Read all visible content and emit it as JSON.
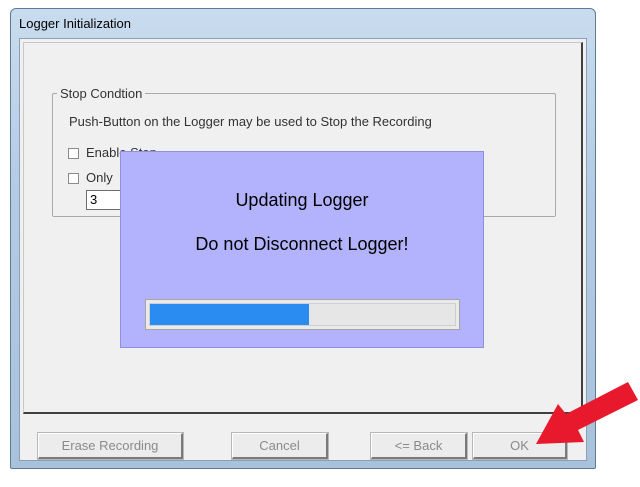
{
  "window": {
    "title": "Logger Initialization"
  },
  "stop_condition": {
    "legend": "Stop Condtion",
    "description": "Push-Button on the Logger may be used to Stop the Recording",
    "enable_stop_label": "Enable Stop",
    "only_label_partial": "Only",
    "number_value": "3"
  },
  "buttons": {
    "erase_recording": "Erase Recording",
    "cancel": "Cancel",
    "back": "<= Back",
    "ok": "OK"
  },
  "overlay": {
    "line1": "Updating Logger",
    "line2": "Do not Disconnect Logger!",
    "progress_fraction": 0.52
  },
  "colors": {
    "overlay_background": "#b3b3fd",
    "progress_fill": "#2a8cf0",
    "arrow": "#e8192c",
    "window_frame": "#b3cbe3"
  },
  "icons": {
    "pointer_arrow": "red-arrow-icon"
  }
}
